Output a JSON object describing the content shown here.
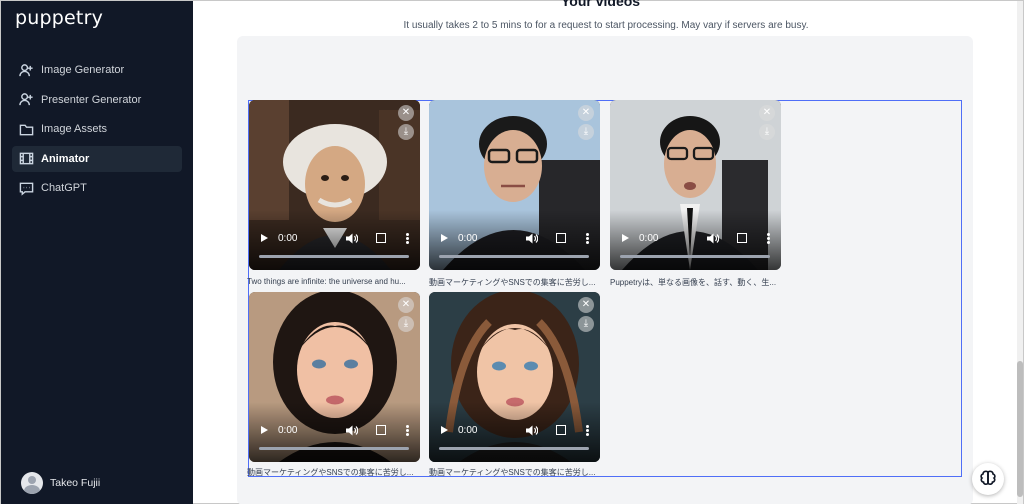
{
  "app": {
    "logo": "puppetry"
  },
  "sidebar": {
    "items": [
      {
        "label": "Image Generator",
        "icon": "user-plus-icon",
        "active": false
      },
      {
        "label": "Presenter Generator",
        "icon": "user-plus-icon",
        "active": false
      },
      {
        "label": "Image Assets",
        "icon": "folder-icon",
        "active": false
      },
      {
        "label": "Animator",
        "icon": "film-icon",
        "active": true
      },
      {
        "label": "ChatGPT",
        "icon": "chat-icon",
        "active": false
      }
    ],
    "user": {
      "name": "Takeo Fujii"
    }
  },
  "main": {
    "title": "Your videos",
    "notice": "It usually takes 2 to 5 mins to for a request to start processing. May vary if servers are busy.",
    "videos": [
      {
        "time": "0:00",
        "caption": "Two things are infinite: the universe and hu..."
      },
      {
        "time": "0:00",
        "caption": "動画マーケティングやSNSでの集客に苦労し..."
      },
      {
        "time": "0:00",
        "caption": "Puppetryは、単なる画像を、話す、動く、生..."
      },
      {
        "time": "0:00",
        "caption": "動画マーケティングやSNSでの集客に苦労し..."
      },
      {
        "time": "0:00",
        "caption": "動画マーケティングやSNSでの集客に苦労し..."
      }
    ]
  },
  "colors": {
    "sidebar_bg": "#111827",
    "accent": "#4f6ef7",
    "panel_bg": "#f3f4f6"
  }
}
